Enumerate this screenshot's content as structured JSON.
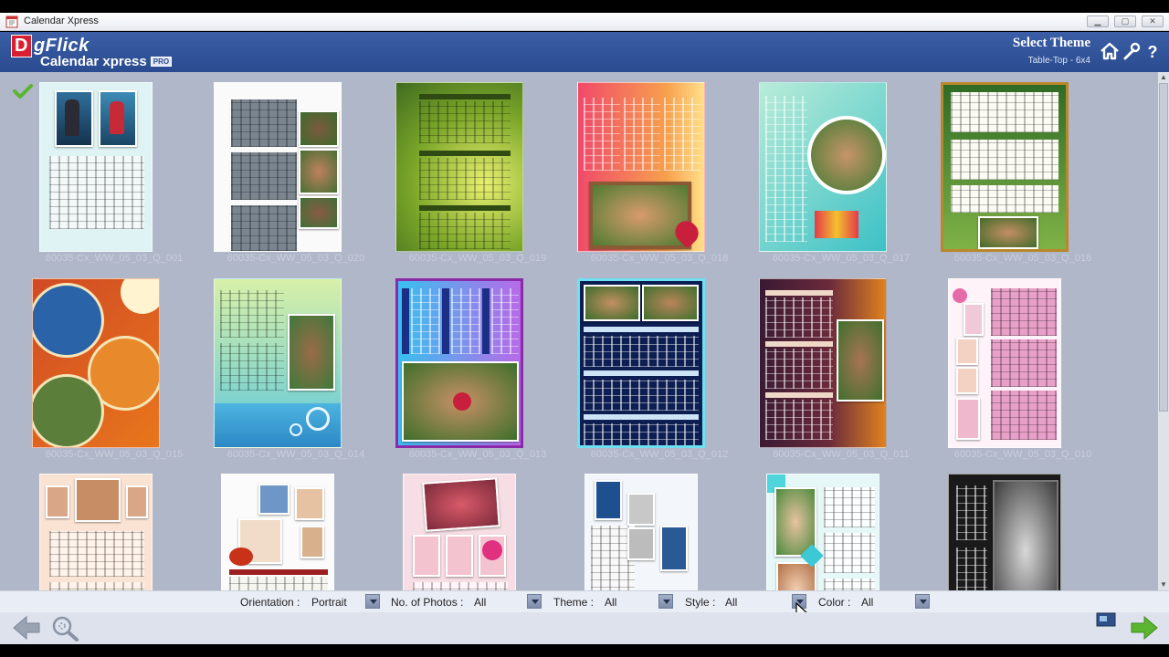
{
  "window": {
    "title": "Calendar Xpress"
  },
  "header": {
    "brand_d": "D",
    "brand_rest": "gFlick",
    "product": "Calendar xpress",
    "product_badge": "PRO",
    "page_title": "Select Theme",
    "page_subtitle": "Table-Top - 6x4"
  },
  "themes": [
    {
      "caption": "60035-Cx_WW_05_03_Q_001",
      "selected": true
    },
    {
      "caption": "60035-Cx_WW_05_03_Q_020"
    },
    {
      "caption": "60035-Cx_WW_05_03_Q_019"
    },
    {
      "caption": "60035-Cx_WW_05_03_Q_018"
    },
    {
      "caption": "60035-Cx_WW_05_03_Q_017"
    },
    {
      "caption": "60035-Cx_WW_05_03_Q_016"
    },
    {
      "caption": "60035-Cx_WW_05_03_Q_015"
    },
    {
      "caption": "60035-Cx_WW_05_03_Q_014"
    },
    {
      "caption": "60035-Cx_WW_05_03_Q_013"
    },
    {
      "caption": "60035-Cx_WW_05_03_Q_012"
    },
    {
      "caption": "60035-Cx_WW_05_03_Q_011"
    },
    {
      "caption": "60035-Cx_WW_05_03_Q_010"
    }
  ],
  "filters": {
    "orientation": {
      "label": "Orientation :",
      "value": "Portrait"
    },
    "photos": {
      "label": "No. of Photos :",
      "value": "All"
    },
    "theme": {
      "label": "Theme :",
      "value": "All"
    },
    "style": {
      "label": "Style :",
      "value": "All"
    },
    "color": {
      "label": "Color :",
      "value": "All"
    }
  },
  "icons": {
    "home": "home-icon",
    "settings": "wrench-icon",
    "help": "help-icon",
    "back": "back-arrow-icon",
    "zoom": "zoom-icon",
    "next": "next-arrow-icon"
  },
  "colors": {
    "header": "#2a4b8f",
    "content_bg": "#b0b7c9",
    "nav_green": "#5cb531"
  }
}
